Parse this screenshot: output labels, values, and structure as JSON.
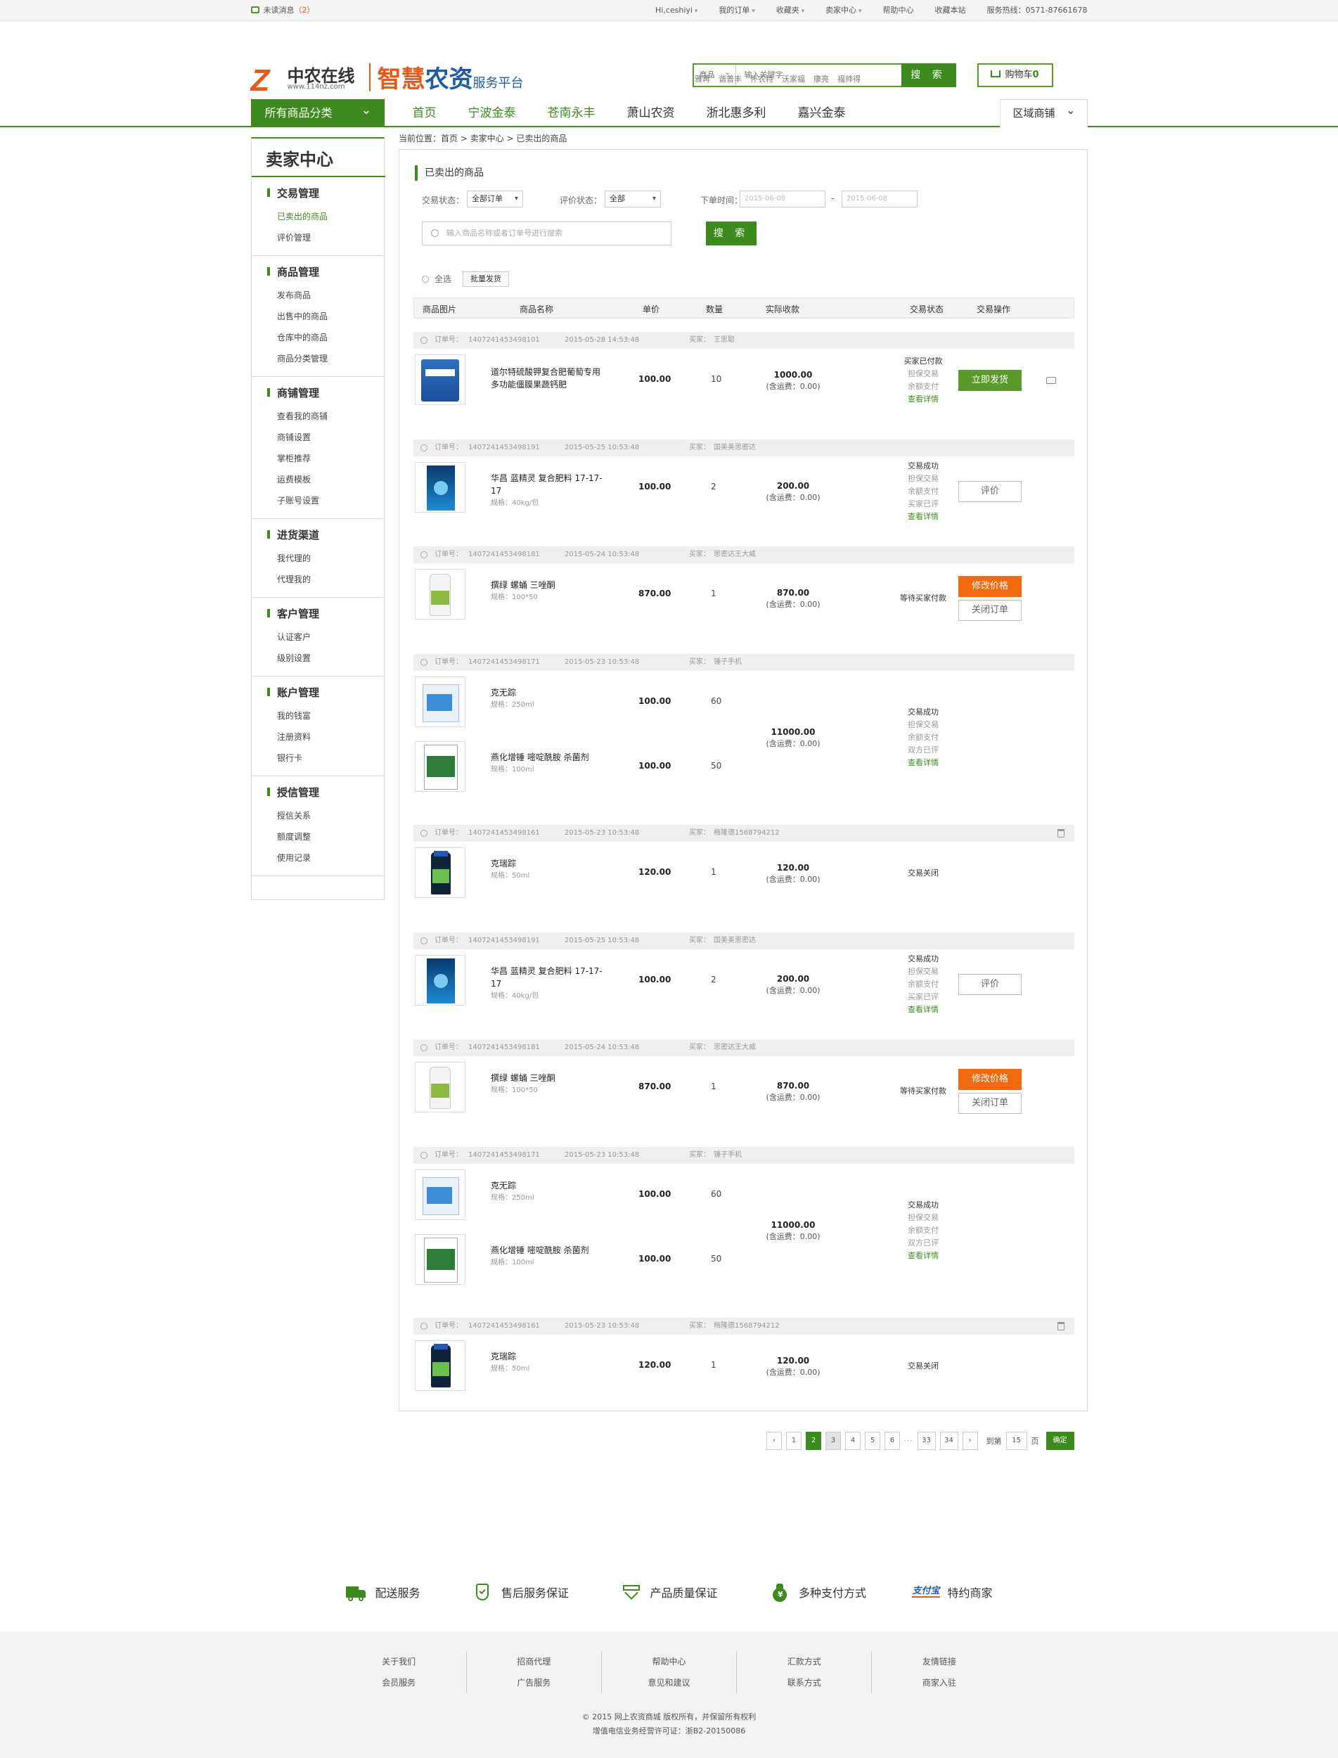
{
  "topbar": {
    "unread_label": "未读消息",
    "unread_count": "（2）",
    "links": [
      "Hi,ceshiyi",
      "我的订单",
      "收藏夹",
      "卖家中心",
      "帮助中心",
      "收藏本站",
      "服务热线：0571-87661678"
    ]
  },
  "logo": {
    "letter": "Z",
    "cn": "中农在线",
    "url": "www.114nz.com",
    "big1": "智慧",
    "big2": "农资",
    "big3": "服务平台"
  },
  "search": {
    "category": "商品",
    "placeholder": "输入关键字",
    "button": "搜 索",
    "hotwords": [
      "雅再",
      "谐普丰",
      "怀农特",
      "沃家福",
      "康亮",
      "福帅得"
    ]
  },
  "cart": {
    "label": "购物车",
    "count": "0"
  },
  "nav": {
    "all_categories": "所有商品分类",
    "items": [
      "首页",
      "宁波金泰",
      "苍南永丰",
      "萧山农资",
      "浙北惠多利",
      "嘉兴金泰"
    ],
    "region": "区域商铺"
  },
  "sidebar": {
    "title": "卖家中心",
    "groups": [
      {
        "title": "交易管理",
        "items": [
          "已卖出的商品",
          "评价管理"
        ]
      },
      {
        "title": "商品管理",
        "items": [
          "发布商品",
          "出售中的商品",
          "仓库中的商品",
          "商品分类管理"
        ]
      },
      {
        "title": "商铺管理",
        "items": [
          "查看我的商铺",
          "商铺设置",
          "掌柜推荐",
          "运费模板",
          "子账号设置"
        ]
      },
      {
        "title": "进货渠道",
        "items": [
          "我代理的",
          "代理我的"
        ]
      },
      {
        "title": "客户管理",
        "items": [
          "认证客户",
          "级别设置"
        ]
      },
      {
        "title": "账户管理",
        "items": [
          "我的钱富",
          "注册资料",
          "银行卡"
        ]
      },
      {
        "title": "授信管理",
        "items": [
          "授信关系",
          "额度调整",
          "使用记录"
        ]
      }
    ]
  },
  "breadcrumb": "当前位置：首页 > 卖家中心 > 已卖出的商品",
  "page_title": "已卖出的商品",
  "filters": {
    "trade_label": "交易状态：",
    "trade_value": "全部订单",
    "rate_label": "评价状态：",
    "rate_value": "全部",
    "time_label": "下单时间：",
    "date_from": "2015-06-08",
    "date_sep": "-",
    "date_to": "2015-06-08",
    "keyword_placeholder": "输入商品名称或者订单号进行搜索",
    "search_button": "搜 索"
  },
  "select_all": "全选",
  "batch_ship": "批量发货",
  "table_headers": [
    "商品图片",
    "商品名称",
    "单价",
    "数量",
    "实际收款",
    "交易状态",
    "交易操作"
  ],
  "labels": {
    "order_no": "订单号：",
    "buyer": "买家：",
    "shipping": "(含运费：0.00)"
  },
  "orders": [
    {
      "no": "1407241453498101",
      "time": "2015-05-28 14:53:48",
      "buyer": "王思聪",
      "products": [
        {
          "name": "道尔特硫酸钾复合肥葡萄专用多功能僵膜果蔬钙肥",
          "spec": "",
          "price": "100.00",
          "qty": "10"
        }
      ],
      "paid": "1000.00",
      "status": [
        "买家已付款",
        "担保交易",
        "余额支付",
        "查看详情"
      ],
      "actions": [
        "立即发货"
      ]
    },
    {
      "no": "1407241453498191",
      "time": "2015-05-25 10:53:48",
      "buyer": "国美美思密达",
      "products": [
        {
          "name": "华昌 蓝精灵 复合肥料 17-17-17",
          "spec": "规格：40kg/包",
          "price": "100.00",
          "qty": "2"
        }
      ],
      "paid": "200.00",
      "status": [
        "交易成功",
        "担保交易",
        "余额支付",
        "买家已评",
        "查看详情"
      ],
      "actions": [
        "评价"
      ]
    },
    {
      "no": "1407241453498181",
      "time": "2015-05-24 10:53:48",
      "buyer": "思密达王大威",
      "products": [
        {
          "name": "撰绿 螺蛹 三唑酮",
          "spec": "规格：100*50",
          "price": "870.00",
          "qty": "1"
        }
      ],
      "paid": "870.00",
      "status": [
        "等待买家付款"
      ],
      "actions": [
        "修改价格",
        "关闭订单"
      ]
    },
    {
      "no": "1407241453498171",
      "time": "2015-05-23 10:53:48",
      "buyer": "锤子手机",
      "products": [
        {
          "name": "克无踪",
          "spec": "规格：250ml",
          "price": "100.00",
          "qty": "60"
        },
        {
          "name": "燕化增锤 嘧啶酰胺 杀菌剂",
          "spec": "规格：100ml",
          "price": "100.00",
          "qty": "50"
        }
      ],
      "paid": "11000.00",
      "status": [
        "交易成功",
        "担保交易",
        "余额支付",
        "双方已评",
        "查看详情"
      ],
      "actions": []
    },
    {
      "no": "1407241453498161",
      "time": "2015-05-23 10:53:48",
      "buyer": "梅隆德1568794212",
      "products": [
        {
          "name": "克瑞踪",
          "spec": "规格：50ml",
          "price": "120.00",
          "qty": "1"
        }
      ],
      "paid": "120.00",
      "status": [
        "交易关闭"
      ],
      "actions": []
    },
    {
      "no": "1407241453498191",
      "time": "2015-05-25 10:53:48",
      "buyer": "国美美思密达",
      "products": [
        {
          "name": "华昌 蓝精灵 复合肥料 17-17-17",
          "spec": "规格：40kg/包",
          "price": "100.00",
          "qty": "2"
        }
      ],
      "paid": "200.00",
      "status": [
        "交易成功",
        "担保交易",
        "余额支付",
        "买家已评",
        "查看详情"
      ],
      "actions": [
        "评价"
      ]
    },
    {
      "no": "1407241453498181",
      "time": "2015-05-24 10:53:48",
      "buyer": "思密达王大威",
      "products": [
        {
          "name": "撰绿 螺蛹 三唑酮",
          "spec": "规格：100*50",
          "price": "870.00",
          "qty": "1"
        }
      ],
      "paid": "870.00",
      "status": [
        "等待买家付款"
      ],
      "actions": [
        "修改价格",
        "关闭订单"
      ]
    },
    {
      "no": "1407241453498171",
      "time": "2015-05-23 10:53:48",
      "buyer": "锤子手机",
      "products": [
        {
          "name": "克无踪",
          "spec": "规格：250ml",
          "price": "100.00",
          "qty": "60"
        },
        {
          "name": "燕化增锤 嘧啶酰胺 杀菌剂",
          "spec": "规格：100ml",
          "price": "100.00",
          "qty": "50"
        }
      ],
      "paid": "11000.00",
      "status": [
        "交易成功",
        "担保交易",
        "余额支付",
        "双方已评",
        "查看详情"
      ],
      "actions": []
    },
    {
      "no": "1407241453498161",
      "time": "2015-05-23 10:53:48",
      "buyer": "梅隆德1568794212",
      "products": [
        {
          "name": "克瑞踪",
          "spec": "规格：50ml",
          "price": "120.00",
          "qty": "1"
        }
      ],
      "paid": "120.00",
      "status": [
        "交易关闭"
      ],
      "actions": []
    }
  ],
  "pager": {
    "prev": "‹",
    "pages": [
      "1",
      "2",
      "3",
      "4",
      "5",
      "6"
    ],
    "ellipsis": "···",
    "tail": [
      "33",
      "34"
    ],
    "next": "›",
    "goto": "到第",
    "current_input": "15",
    "page_unit": "页",
    "confirm": "确定"
  },
  "services": [
    "配送服务",
    "售后服务保证",
    "产品质量保证",
    "多种支付方式",
    "特约商家"
  ],
  "footer": {
    "cols": [
      [
        "关于我们",
        "会员服务"
      ],
      [
        "招商代理",
        "广告服务"
      ],
      [
        "帮助中心",
        "意见和建议"
      ],
      [
        "汇款方式",
        "联系方式"
      ],
      [
        "友情链接",
        "商家入驻"
      ]
    ],
    "copyright": "© 2015 网上农资商城 版权所有，并保留所有权利",
    "license": "增值电信业务经营许可证：浙B2-20150086"
  },
  "colors": {
    "green": "#3d8a1e",
    "orange": "#f26a10",
    "brand_orange": "#e55a16",
    "brand_blue": "#1e5aa8"
  }
}
